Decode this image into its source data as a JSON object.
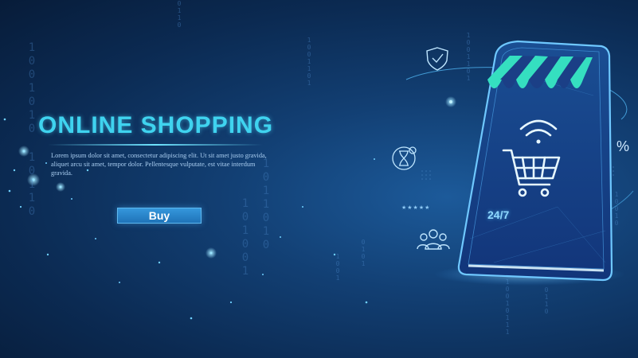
{
  "headline": "ONLINE SHOPPING",
  "description": "Lorem ipsum dolor sit amet, consectetur adipiscing elit. Ut sit amet justo gravida, aliquet arcu sit amet, tempor dolor. Pellentesque vulputate, est vitae interdum gravida.",
  "buy_label": "Buy",
  "phone": {
    "availability": "24/7"
  },
  "percent_symbol": "%",
  "rating_stars": "★★★★★",
  "binary_columns": [
    "1001010",
    "10110",
    "1001101",
    "0110",
    "101001",
    "1011010",
    "1001",
    "0101",
    "1001101",
    "10010",
    "10010111",
    "0110"
  ],
  "colors": {
    "accent": "#3fd3ef",
    "awning_teal": "#35dfc0",
    "awning_blue": "#1b3f86",
    "button": "#2b8ad1"
  },
  "icons": [
    "shield-check-icon",
    "hourglass-icon",
    "wifi-icon",
    "shopping-cart-icon",
    "users-icon"
  ]
}
